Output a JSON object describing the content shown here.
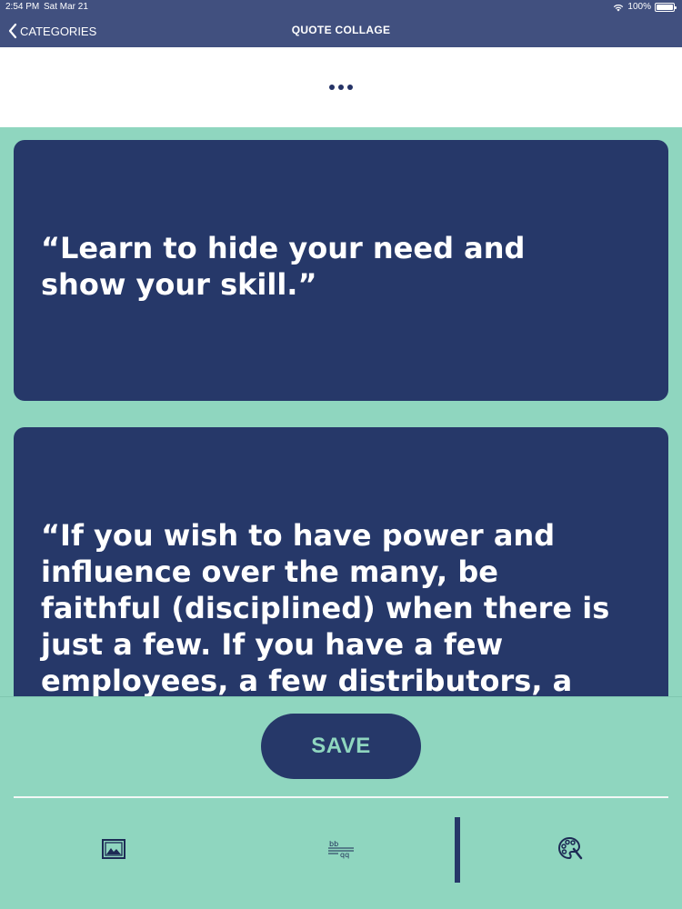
{
  "status": {
    "time": "2:54 PM",
    "date": "Sat Mar 21",
    "battery": "100%"
  },
  "nav": {
    "back_label": "CATEGORIES",
    "title": "QUOTE COLLAGE"
  },
  "cards": [
    {
      "text": "“Learn to hide your need and show your skill.”"
    },
    {
      "text": "“If you wish to have power and influence over the many, be faithful (disciplined) when there is just a few. If you have a few employees, a few distributors, a few people, that's the"
    }
  ],
  "actions": {
    "save_label": "SAVE"
  },
  "toolbar": {
    "icons": [
      "image-icon",
      "font-style-icon",
      "palette-icon"
    ]
  },
  "colors": {
    "nav_bg": "#41507f",
    "card_bg": "#263869",
    "page_bg": "#8fd6bf",
    "save_text": "#8fd6bf"
  }
}
